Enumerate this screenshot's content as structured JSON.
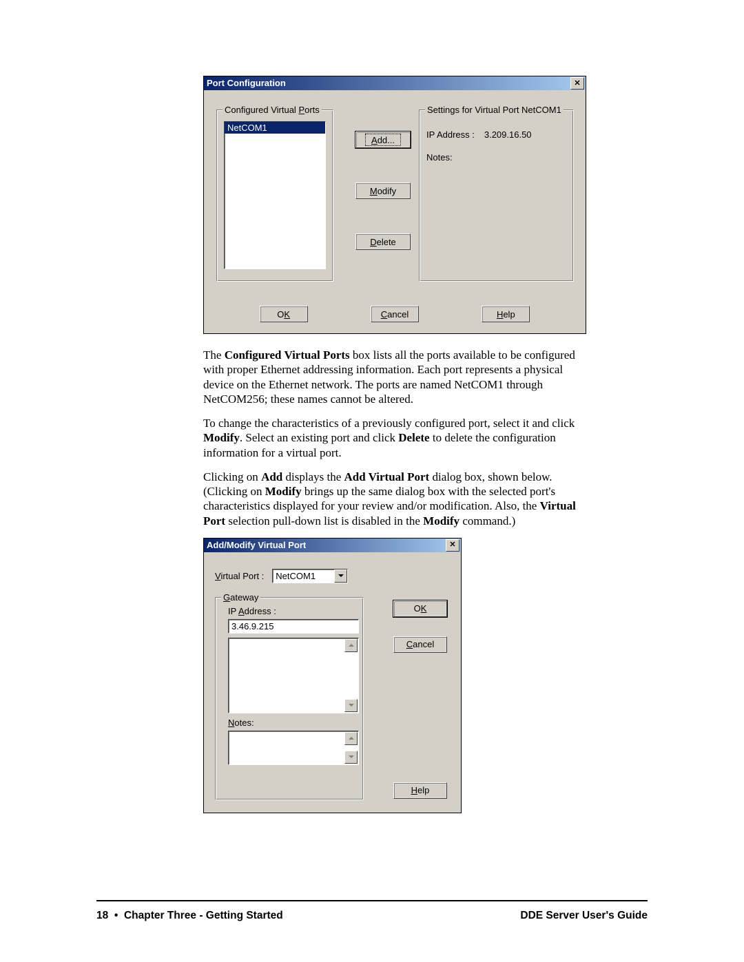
{
  "dialog1": {
    "title": "Port Configuration",
    "ports_group_label": "Configured Virtual Ports",
    "ports": [
      "NetCOM1"
    ],
    "add_label": "Add...",
    "modify_label": "Modify",
    "delete_label": "Delete",
    "settings_group_label": "Settings for Virtual Port  NetCOM1",
    "ip_label": "IP Address :",
    "ip_value": "3.209.16.50",
    "notes_label": "Notes:",
    "ok_label": "OK",
    "cancel_label": "Cancel",
    "help_label": "Help"
  },
  "para1_pre": "The ",
  "para1_b1": "Configured Virtual Ports",
  "para1_post": " box lists all the ports available to be configured with proper Ethernet addressing information. Each port represents a physical device on the Ethernet network. The ports are named NetCOM1 through NetCOM256; these names cannot be altered.",
  "para2_a": "To change the characteristics of a previously configured port, select it and click ",
  "para2_b1": "Modify",
  "para2_b": ". Select an existing port and click ",
  "para2_b2": "Delete",
  "para2_c": " to delete the configuration information for a virtual port.",
  "para3_a": "Clicking on ",
  "para3_b1": "Add",
  "para3_b": " displays the ",
  "para3_b2": "Add Virtual Port",
  "para3_c": " dialog box, shown below. (Clicking on ",
  "para3_b3": "Modify",
  "para3_d": " brings up the same dialog box with the selected port's characteristics displayed for your review and/or modification. Also, the ",
  "para3_b4": "Virtual Port",
  "para3_e": " selection pull-down list is disabled in the ",
  "para3_b5": "Modify",
  "para3_f": " command.)",
  "dialog2": {
    "title": "Add/Modify Virtual Port",
    "vp_label": "Virtual Port :",
    "vp_value": "NetCOM1",
    "gateway_label": "Gateway",
    "ip_label": "IP Address :",
    "ip_value": "3.46.9.215",
    "notes_label": "Notes:",
    "ok_label": "OK",
    "cancel_label": "Cancel",
    "help_label": "Help"
  },
  "footer": {
    "page": "18",
    "bullet": "•",
    "left": "Chapter Three - Getting Started",
    "right": "DDE Server User's Guide"
  }
}
